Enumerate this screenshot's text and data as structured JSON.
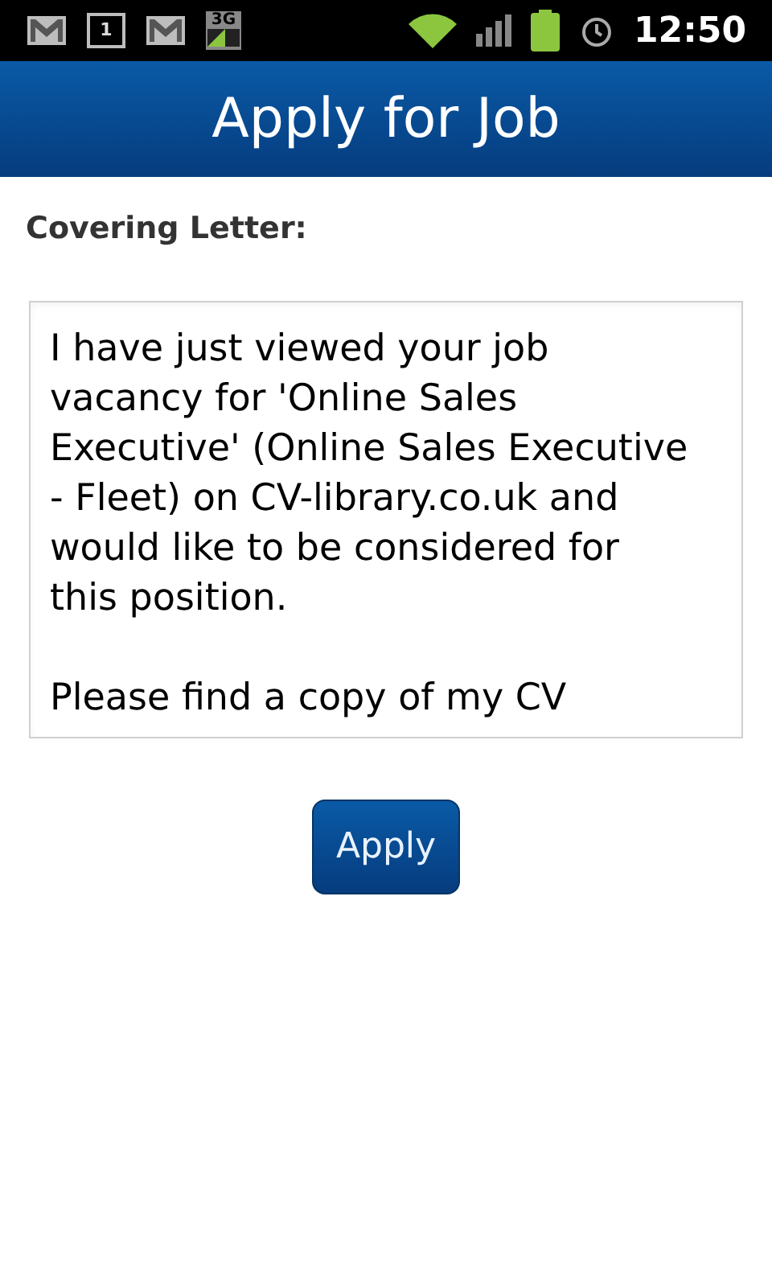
{
  "status_bar": {
    "notifications": [
      {
        "kind": "mail"
      },
      {
        "kind": "calendar",
        "text": "1"
      },
      {
        "kind": "mail"
      },
      {
        "kind": "network",
        "text": "3G"
      }
    ],
    "time": "12:50"
  },
  "header": {
    "title": "Apply for Job"
  },
  "form": {
    "label": "Covering Letter:",
    "value": "I have just viewed your job\nvacancy for 'Online Sales\nExecutive' (Online Sales Executive\n- Fleet) on CV-library.co.uk and\nwould like to be considered for\nthis position.\n\nPlease find a copy of my CV"
  },
  "button": "Apply"
}
